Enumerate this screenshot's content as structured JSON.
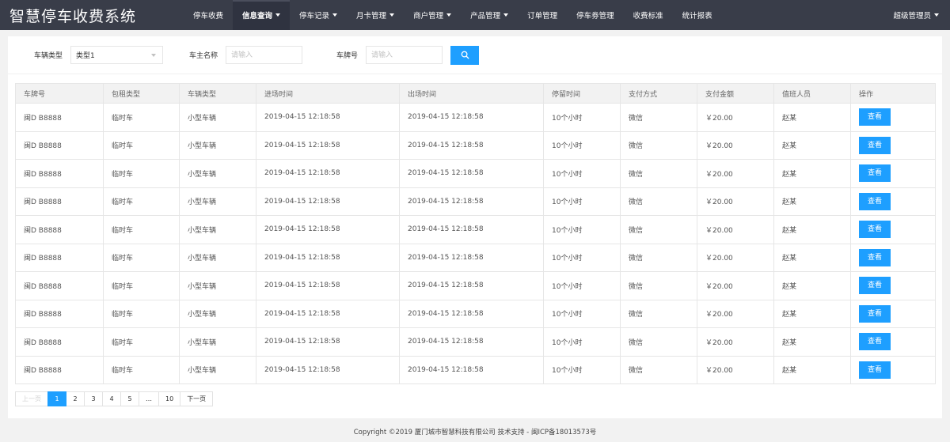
{
  "header": {
    "brand": "智慧停车收费系统",
    "user": "超级管理员",
    "nav": [
      {
        "label": "停车收费",
        "dropdown": false,
        "active": false
      },
      {
        "label": "信息查询",
        "dropdown": true,
        "active": true
      },
      {
        "label": "停车记录",
        "dropdown": true,
        "active": false
      },
      {
        "label": "月卡管理",
        "dropdown": true,
        "active": false
      },
      {
        "label": "商户管理",
        "dropdown": true,
        "active": false
      },
      {
        "label": "产品管理",
        "dropdown": true,
        "active": false
      },
      {
        "label": "订单管理",
        "dropdown": false,
        "active": false
      },
      {
        "label": "停车劵管理",
        "dropdown": false,
        "active": false
      },
      {
        "label": "收费标准",
        "dropdown": false,
        "active": false
      },
      {
        "label": "统计报表",
        "dropdown": false,
        "active": false
      }
    ]
  },
  "filters": {
    "vehicle_type_label": "车辆类型",
    "vehicle_type_value": "类型1",
    "owner_label": "车主名称",
    "owner_placeholder": "请输入",
    "plate_label": "车牌号",
    "plate_placeholder": "请输入"
  },
  "table": {
    "columns": [
      "车牌号",
      "包租类型",
      "车辆类型",
      "进场时间",
      "出场时间",
      "停留时间",
      "支付方式",
      "支付金额",
      "值班人员",
      "操作"
    ],
    "action_label": "查看",
    "rows": [
      [
        "闽D B8888",
        "临时车",
        "小型车辆",
        "2019-04-15 12:18:58",
        "2019-04-15 12:18:58",
        "10个小时",
        "微信",
        "￥20.00",
        "赵某"
      ],
      [
        "闽D B8888",
        "临时车",
        "小型车辆",
        "2019-04-15 12:18:58",
        "2019-04-15 12:18:58",
        "10个小时",
        "微信",
        "￥20.00",
        "赵某"
      ],
      [
        "闽D B8888",
        "临时车",
        "小型车辆",
        "2019-04-15 12:18:58",
        "2019-04-15 12:18:58",
        "10个小时",
        "微信",
        "￥20.00",
        "赵某"
      ],
      [
        "闽D B8888",
        "临时车",
        "小型车辆",
        "2019-04-15 12:18:58",
        "2019-04-15 12:18:58",
        "10个小时",
        "微信",
        "￥20.00",
        "赵某"
      ],
      [
        "闽D B8888",
        "临时车",
        "小型车辆",
        "2019-04-15 12:18:58",
        "2019-04-15 12:18:58",
        "10个小时",
        "微信",
        "￥20.00",
        "赵某"
      ],
      [
        "闽D B8888",
        "临时车",
        "小型车辆",
        "2019-04-15 12:18:58",
        "2019-04-15 12:18:58",
        "10个小时",
        "微信",
        "￥20.00",
        "赵某"
      ],
      [
        "闽D B8888",
        "临时车",
        "小型车辆",
        "2019-04-15 12:18:58",
        "2019-04-15 12:18:58",
        "10个小时",
        "微信",
        "￥20.00",
        "赵某"
      ],
      [
        "闽D B8888",
        "临时车",
        "小型车辆",
        "2019-04-15 12:18:58",
        "2019-04-15 12:18:58",
        "10个小时",
        "微信",
        "￥20.00",
        "赵某"
      ],
      [
        "闽D B8888",
        "临时车",
        "小型车辆",
        "2019-04-15 12:18:58",
        "2019-04-15 12:18:58",
        "10个小时",
        "微信",
        "￥20.00",
        "赵某"
      ],
      [
        "闽D B8888",
        "临时车",
        "小型车辆",
        "2019-04-15 12:18:58",
        "2019-04-15 12:18:58",
        "10个小时",
        "微信",
        "￥20.00",
        "赵某"
      ]
    ]
  },
  "pagination": {
    "prev": "上一页",
    "pages": [
      "1",
      "2",
      "3",
      "4",
      "5",
      "…",
      "10"
    ],
    "current": "1",
    "next": "下一页"
  },
  "footer": {
    "text": "Copyright ©2019 厦门城市智慧科技有限公司 技术支持 - 闽ICP备18013573号"
  },
  "colors": {
    "header_bg": "#393d49",
    "accent": "#1e9fff"
  },
  "icons": {
    "search_button": "search-icon",
    "nav_dropdown": "caret-down-icon",
    "user_dropdown": "caret-down-icon",
    "select_dropdown": "chevron-down-icon"
  }
}
